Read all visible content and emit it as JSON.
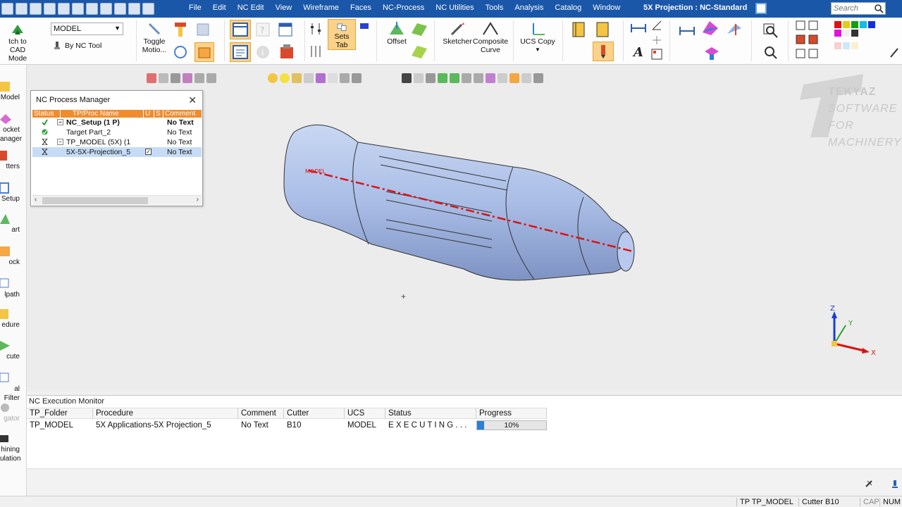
{
  "window": {
    "title": "5X Projection : NC-Standard",
    "search_placeholder": "Search"
  },
  "menu": [
    "File",
    "Edit",
    "NC Edit",
    "View",
    "Wireframe",
    "Faces",
    "NC-Process",
    "NC Utilities",
    "Tools",
    "Analysis",
    "Catalog",
    "Window"
  ],
  "ribbon": {
    "switch_cad": "tch to CAD",
    "switch_mode": "Mode",
    "model_combo": "MODEL",
    "by_nc_tool": "By NC Tool",
    "toggle": "Toggle",
    "toggle2": "Motio...",
    "sets_tab": "Sets Tab",
    "offset": "Offset",
    "sketcher": "Sketcher",
    "composite": "Composite",
    "curve": "Curve",
    "ucs_copy": "UCS Copy"
  },
  "left_toolbar": [
    {
      "label": "Model",
      "color": "#f4c542"
    },
    {
      "label": "ocket",
      "color": "#d46cd4"
    },
    {
      "label": "anager",
      "color": "#d46cd4"
    },
    {
      "label": "tters",
      "color": "#d84a2b"
    },
    {
      "label": "Setup",
      "color": "#4a7fd4"
    },
    {
      "label": "art",
      "color": "#5cb85c"
    },
    {
      "label": "ock",
      "color": "#f4a742"
    },
    {
      "label": "lpath",
      "color": "#4a7fd4"
    },
    {
      "label": "edure",
      "color": "#f4c542"
    },
    {
      "label": "cute",
      "color": "#5cb85c"
    },
    {
      "label": "al Filter",
      "color": "#4a7fd4"
    },
    {
      "label": "gator",
      "color": "#aaaaaa"
    },
    {
      "label": "hining",
      "color": "#333333"
    },
    {
      "label": "ulation",
      "color": "#333333"
    }
  ],
  "process_manager": {
    "title": "NC Process Manager",
    "columns": [
      "Status",
      "TP/Proc Name",
      "U",
      "S",
      "Comment"
    ],
    "rows": [
      {
        "name": "NC_Setup (1 P)",
        "comment": "No Text"
      },
      {
        "name": "Target Part_2",
        "comment": "No Text"
      },
      {
        "name": "TP_MODEL (5X) (1",
        "comment": "No Text"
      },
      {
        "name": "5X-5X-Projection_5",
        "comment": "No Text"
      }
    ]
  },
  "viewport": {
    "part_label": "MODEL",
    "triad": {
      "z": "Z",
      "y": "Y",
      "x": "X"
    },
    "watermark": {
      "line1": "TEKYAZ",
      "line2": "SOFTWARE FOR",
      "line3": "MACHINERY"
    }
  },
  "execution_monitor": {
    "title": "NC Execution Monitor",
    "columns": [
      "TP_Folder",
      "Procedure",
      "Comment",
      "Cutter",
      "UCS",
      "Status",
      "Progress"
    ],
    "row": {
      "tp_folder": "TP_MODEL",
      "procedure": "5X Applications-5X Projection_5",
      "comment": "No Text",
      "cutter": "B10",
      "ucs": "MODEL",
      "status": "E X E C U T I N G . . .",
      "progress_text": "10%",
      "progress_value": 0.1
    }
  },
  "statusbar": {
    "tp": "TP  TP_MODEL",
    "cutter": "Cutter  B10",
    "cap": "CAP",
    "num": "NUM"
  },
  "colors": {
    "title_bar": "#1a57a8",
    "header_orange": "#f08c2e",
    "part_blue": "#a9bde6",
    "axis_red": "#e01010",
    "progress": "#2a7fd9"
  }
}
